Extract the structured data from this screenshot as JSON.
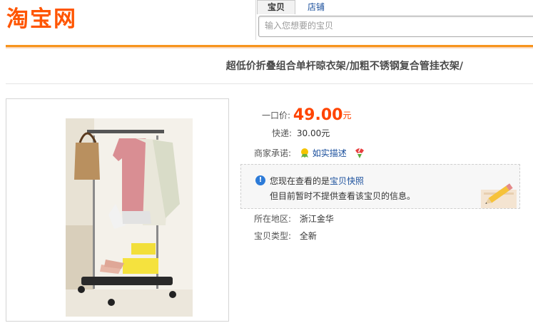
{
  "header": {
    "logo_text": "淘宝网",
    "tabs": [
      {
        "label": "宝贝",
        "active": true
      },
      {
        "label": "店铺",
        "active": false
      }
    ],
    "search_placeholder": "输入您想要的宝贝"
  },
  "item": {
    "title": "超低价折叠组合单杆晾衣架/加粗不锈钢复合管挂衣架/",
    "price_label": "一口价:",
    "price_value": "49.00",
    "price_unit": "元",
    "shipping_label": "快递:",
    "shipping_value": "30.00元",
    "promise_label": "商家承诺:",
    "promise_link": "如实描述",
    "promise_badge": "7",
    "notice_prefix": "您现在查看的是",
    "notice_link": "宝贝快照",
    "notice_line2": "但目前暂时不提供查看该宝贝的信息。",
    "location_label": "所在地区:",
    "location_value": "浙江金华",
    "condition_label": "宝贝类型:",
    "condition_value": "全新"
  },
  "colors": {
    "brand": "#ff5500",
    "accent_line": "#f7941d",
    "price": "#ff4400",
    "link": "#1a4f9c",
    "info_icon": "#2d7bd8"
  },
  "icons": [
    "info-icon",
    "ribbon-badge-icon",
    "seven-day-badge-icon",
    "pencil-icon"
  ]
}
